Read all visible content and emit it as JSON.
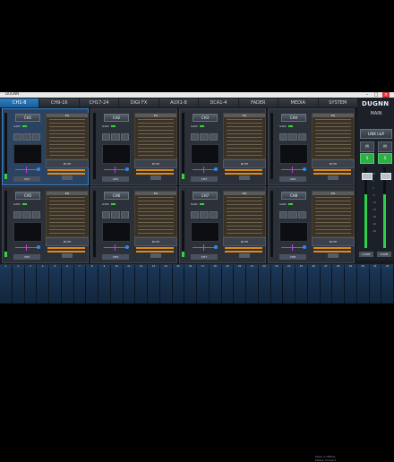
{
  "window": {
    "title": "DUGNN",
    "min_icon": "minimize-icon",
    "max_icon": "maximize-icon",
    "close_icon": "close-icon"
  },
  "tabs": [
    {
      "label": "CH1-8"
    },
    {
      "label": "CH9-16"
    },
    {
      "label": "CH17-24"
    },
    {
      "label": "DIGI FX"
    },
    {
      "label": "AUX1-8"
    },
    {
      "label": "DCA1-4"
    },
    {
      "label": "FADER"
    },
    {
      "label": "MEDIA"
    },
    {
      "label": "SYSTEM"
    }
  ],
  "brand": {
    "logo": "DUGNN",
    "section": "MAIN"
  },
  "strips": [
    {
      "name": "CH1",
      "selected": true
    },
    {
      "name": "CH2"
    },
    {
      "name": "CH3"
    },
    {
      "name": "CH4"
    },
    {
      "name": "CH5"
    },
    {
      "name": "CH6"
    },
    {
      "name": "CH7"
    },
    {
      "name": "CH8"
    }
  ],
  "strip_labels": {
    "gain": "GAIN",
    "eq": "EQ",
    "mute": "MUTE"
  },
  "main": {
    "link": "LINK L&P",
    "m1": "M",
    "m2": "M",
    "s1": "S",
    "s2": "S",
    "left": "0.0dB",
    "right": "0.0dB",
    "scale": [
      "10",
      "5",
      "0",
      "-5",
      "-10",
      "-20",
      "-30",
      "-40",
      "-60"
    ]
  },
  "bottom_numbers": [
    "1",
    "2",
    "3",
    "4",
    "5",
    "6",
    "7",
    "8",
    "9",
    "10",
    "11",
    "12",
    "13",
    "14",
    "15",
    "16",
    "17",
    "18",
    "19",
    "20",
    "21",
    "22",
    "23",
    "24",
    "25",
    "26",
    "27",
    "28",
    "29",
    "30",
    "31",
    "32"
  ],
  "info": {
    "line1": "Mixer is Offline",
    "line2": "Please Connect"
  }
}
